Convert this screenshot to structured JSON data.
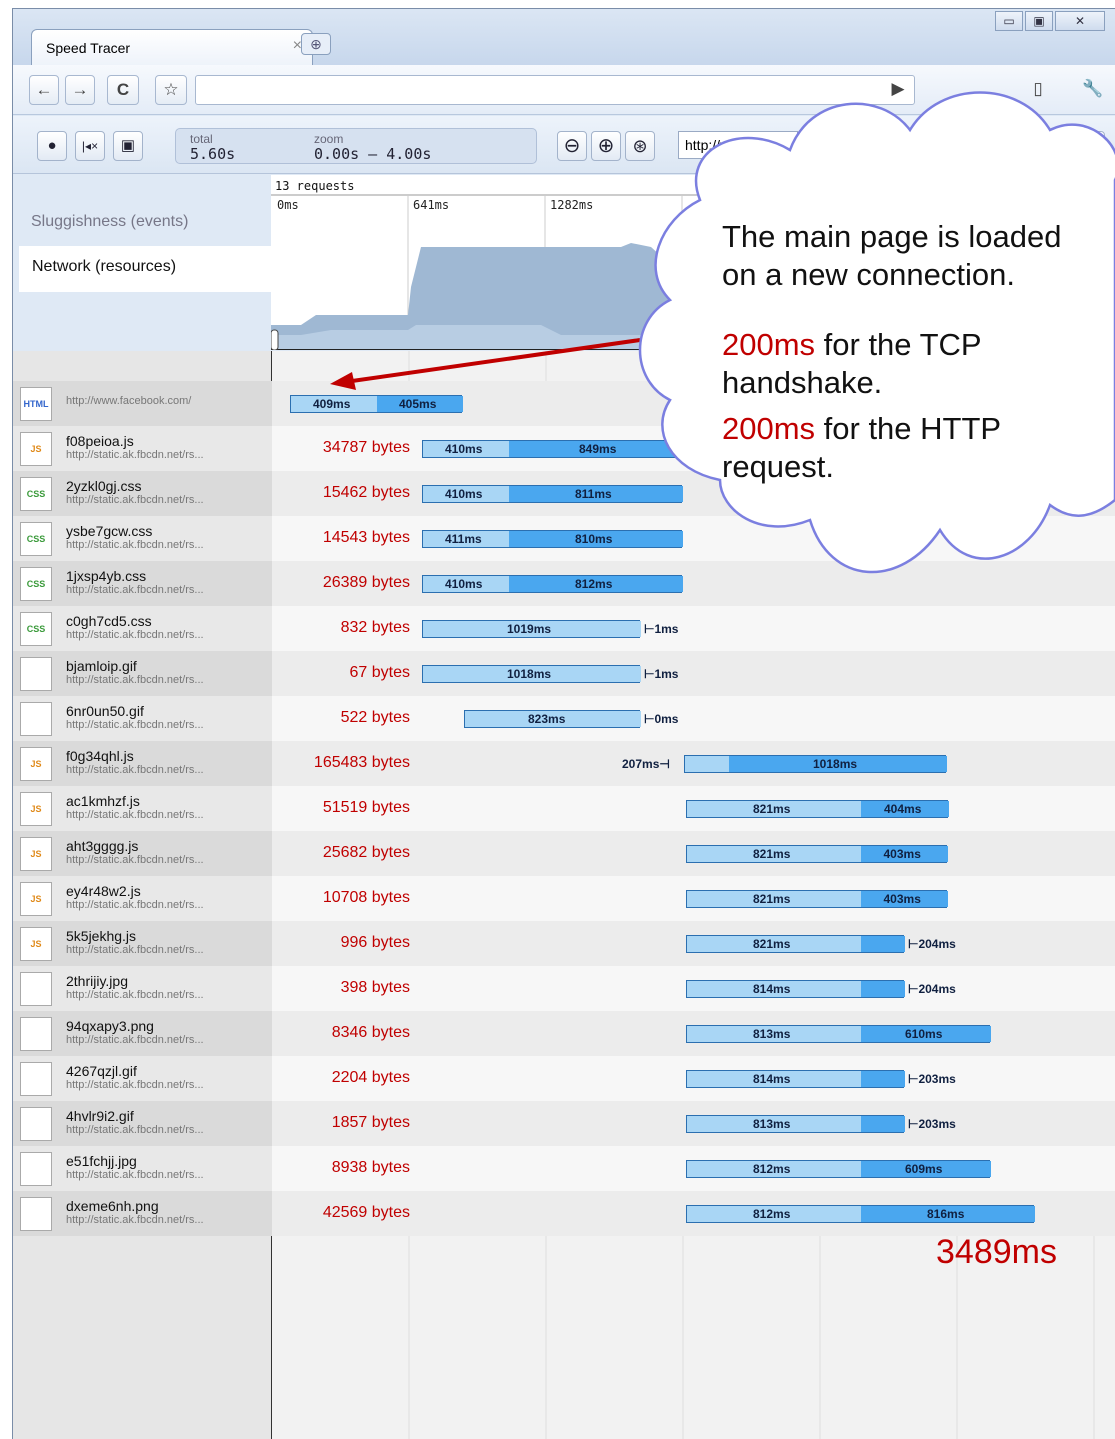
{
  "window": {
    "tab_title": "Speed Tracer",
    "tab_close": "×",
    "new_tab": "⊕",
    "minimize": "▭",
    "maximize": "▣",
    "close": "✕"
  },
  "browser_toolbar": {
    "back": "←",
    "forward": "→",
    "reload": "C",
    "star": "☆",
    "play": "▶",
    "page_menu": "▯",
    "wrench": "🔧"
  },
  "speed_tracer": {
    "record": "●",
    "clear": "|◂×",
    "save": "▣",
    "total_label": "total",
    "total_value": "5.60s",
    "zoom_label": "zoom",
    "zoom_value": "0.00s – 4.00s",
    "zoom_out": "⊖",
    "zoom_in": "⊕",
    "zoom_fit": "⊛",
    "url": "http://www",
    "help": "?"
  },
  "overview": {
    "requests": "13 requests",
    "ticks": [
      "0ms",
      "641ms",
      "1282ms"
    ],
    "rows": {
      "sluggishness": "Sluggishness (events)",
      "network": "Network (resources)"
    }
  },
  "annotation": {
    "line1": "The main page is loaded",
    "line2": "on a new connection.",
    "l3_red": "200ms",
    "l3_rest": " for the TCP",
    "line4": "handshake.",
    "l5_red": "200ms",
    "l5_rest": " for the HTTP",
    "line6": "request."
  },
  "total_time": "3489ms",
  "resources": [
    {
      "name": "",
      "url": "http://www.facebook.com/",
      "bytes": "",
      "type": "HTML",
      "a": "409ms",
      "b": "405ms"
    },
    {
      "name": "f08peioa.js",
      "url": "http://static.ak.fbcdn.net/rs...",
      "bytes": "34787 bytes",
      "type": "JS",
      "a": "410ms",
      "b": "849ms"
    },
    {
      "name": "2yzkl0gj.css",
      "url": "http://static.ak.fbcdn.net/rs...",
      "bytes": "15462 bytes",
      "type": "CSS",
      "a": "410ms",
      "b": "811ms"
    },
    {
      "name": "ysbe7gcw.css",
      "url": "http://static.ak.fbcdn.net/rs...",
      "bytes": "14543 bytes",
      "type": "CSS",
      "a": "411ms",
      "b": "810ms"
    },
    {
      "name": "1jxsp4yb.css",
      "url": "http://static.ak.fbcdn.net/rs...",
      "bytes": "26389 bytes",
      "type": "CSS",
      "a": "410ms",
      "b": "812ms"
    },
    {
      "name": "c0gh7cd5.css",
      "url": "http://static.ak.fbcdn.net/rs...",
      "bytes": "832 bytes",
      "type": "CSS",
      "a": "1019ms",
      "b": "1ms"
    },
    {
      "name": "bjamloip.gif",
      "url": "http://static.ak.fbcdn.net/rs...",
      "bytes": "67 bytes",
      "type": "",
      "a": "1018ms",
      "b": "1ms"
    },
    {
      "name": "6nr0un50.gif",
      "url": "http://static.ak.fbcdn.net/rs...",
      "bytes": "522 bytes",
      "type": "",
      "a": "823ms",
      "b": "0ms"
    },
    {
      "name": "f0g34qhl.js",
      "url": "http://static.ak.fbcdn.net/rs...",
      "bytes": "165483 bytes",
      "type": "JS",
      "a": "207ms",
      "b": "1018ms"
    },
    {
      "name": "ac1kmhzf.js",
      "url": "http://static.ak.fbcdn.net/rs...",
      "bytes": "51519 bytes",
      "type": "JS",
      "a": "821ms",
      "b": "404ms"
    },
    {
      "name": "aht3gggg.js",
      "url": "http://static.ak.fbcdn.net/rs...",
      "bytes": "25682 bytes",
      "type": "JS",
      "a": "821ms",
      "b": "403ms"
    },
    {
      "name": "ey4r48w2.js",
      "url": "http://static.ak.fbcdn.net/rs...",
      "bytes": "10708 bytes",
      "type": "JS",
      "a": "821ms",
      "b": "403ms"
    },
    {
      "name": "5k5jekhg.js",
      "url": "http://static.ak.fbcdn.net/rs...",
      "bytes": "996 bytes",
      "type": "JS",
      "a": "821ms",
      "b": "204ms"
    },
    {
      "name": "2thrijiy.jpg",
      "url": "http://static.ak.fbcdn.net/rs...",
      "bytes": "398 bytes",
      "type": "",
      "a": "814ms",
      "b": "204ms"
    },
    {
      "name": "94qxapy3.png",
      "url": "http://static.ak.fbcdn.net/rs...",
      "bytes": "8346 bytes",
      "type": "",
      "a": "813ms",
      "b": "610ms"
    },
    {
      "name": "4267qzjl.gif",
      "url": "http://static.ak.fbcdn.net/rs...",
      "bytes": "2204 bytes",
      "type": "",
      "a": "814ms",
      "b": "203ms"
    },
    {
      "name": "4hvlr9i2.gif",
      "url": "http://static.ak.fbcdn.net/rs...",
      "bytes": "1857 bytes",
      "type": "",
      "a": "813ms",
      "b": "203ms"
    },
    {
      "name": "e51fchjj.jpg",
      "url": "http://static.ak.fbcdn.net/rs...",
      "bytes": "8938 bytes",
      "type": "",
      "a": "812ms",
      "b": "609ms"
    },
    {
      "name": "dxeme6nh.png",
      "url": "http://static.ak.fbcdn.net/rs...",
      "bytes": "42569 bytes",
      "type": "",
      "a": "812ms",
      "b": "816ms"
    }
  ]
}
